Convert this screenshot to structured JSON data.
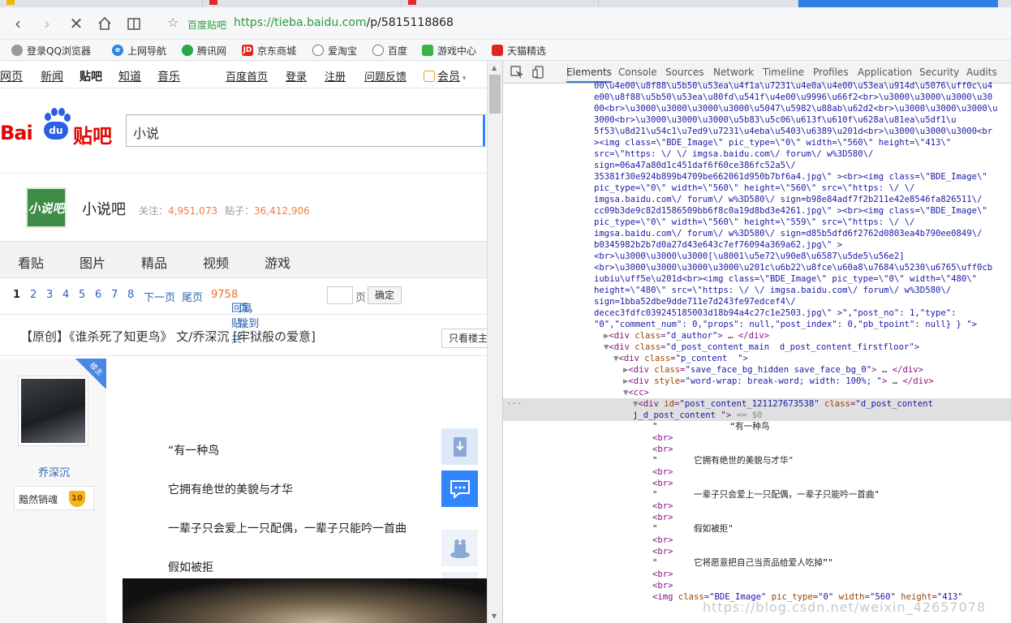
{
  "browser": {
    "site_name": "百度贴吧",
    "url_domain": "https://tieba.baidu.com",
    "url_path": "/p/5815118868",
    "bookmarks": [
      "登录QQ浏览器",
      "上网导航",
      "腾讯网",
      "京东商城",
      "爱淘宝",
      "百度",
      "游戏中心",
      "天猫精选"
    ]
  },
  "tieba": {
    "topnav": [
      "网页",
      "新闻",
      "贴吧",
      "知道",
      "音乐",
      "百度首页",
      "登录",
      "注册",
      "问题反馈",
      "会员"
    ],
    "search_value": "小说",
    "forum_name": "小说吧",
    "forum_avatar_text": "小说吧",
    "followers_label": "关注：",
    "followers": "4,951,073",
    "posts_label": "贴子：",
    "posts": "36,412,906",
    "tabs": [
      "看贴",
      "图片",
      "精品",
      "视频",
      "游戏"
    ],
    "pager": {
      "pages": [
        "1",
        "2",
        "3",
        "4",
        "5",
        "6",
        "7",
        "8"
      ],
      "next": "下一页",
      "last": "尾页",
      "replies": "975",
      "summary_a": "回复贴，共",
      "total_pages": "8",
      "summary_b": "页，跳到",
      "page_unit": "页",
      "confirm": "确定"
    },
    "thread_title": "【原创】《谁杀死了知更鸟》 文/乔深沉 [牢狱般の爱意]",
    "only_author": "只看楼主",
    "op_badge": "楼主",
    "author": "乔深沉",
    "author_badge": "黯然销魂",
    "author_level": "10",
    "post_lines": [
      "“有一种鸟",
      "它拥有绝世的美貌与才华",
      "一辈子只会爱上一只配偶，一辈子只能吟一首曲",
      "假如被拒",
      "它将愿意把自己当贡品给爱人吃掉”"
    ]
  },
  "devtools": {
    "tabs": [
      "Elements",
      "Console",
      "Sources",
      "Network",
      "Timeline",
      "Profiles",
      "Application",
      "Security",
      "Audits"
    ],
    "watermark": "https://blog.csdn.net/weixin_42657078"
  }
}
